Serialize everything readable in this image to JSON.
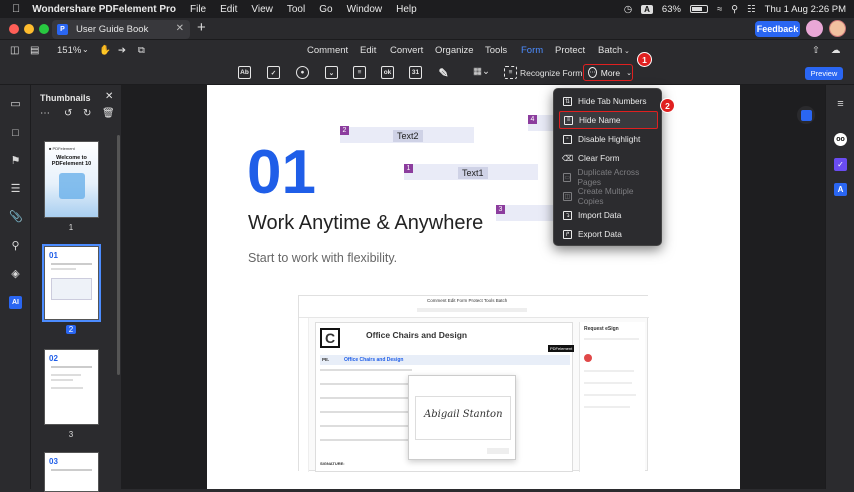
{
  "menubar": {
    "app_name": "Wondershare PDFelement Pro",
    "items": [
      "File",
      "Edit",
      "View",
      "Tool",
      "Go",
      "Window",
      "Help"
    ],
    "input_badge": "A",
    "battery": "63%",
    "datetime": "Thu 1 Aug  2:26 PM"
  },
  "tabbar": {
    "doc_title": "User Guide Book",
    "feedback_label": "Feedback"
  },
  "toolbar": {
    "zoom": "151%",
    "tabs": [
      "Comment",
      "Edit",
      "Convert",
      "Organize",
      "Tools",
      "Form",
      "Protect",
      "Batch"
    ],
    "active_tab": "Form",
    "recognize_form": "Recognize Form",
    "more_label": "More",
    "preview_label": "Preview"
  },
  "thumbnails": {
    "title": "Thumbnails",
    "pages": [
      "1",
      "2",
      "3"
    ],
    "selected": "2",
    "p1_title": "Welcome to PDFelement 10",
    "p2_num": "01",
    "p3_num": "02",
    "p4_num": "03"
  },
  "page": {
    "big_number": "01",
    "heading": "Work Anytime & Anywhere",
    "subheading": "Start to work with flexibility.",
    "fields": [
      {
        "num": "2",
        "label": "Text2"
      },
      {
        "num": "1",
        "label": "Text1"
      },
      {
        "num": "4",
        "label": ""
      },
      {
        "num": "3",
        "label": ""
      }
    ]
  },
  "mini_screenshot": {
    "tabs": "Comment   Edit   Form   Protect   Tools   Batch",
    "doc_title": "Office Chairs and Design",
    "row_header": "Office Chairs and Design",
    "side_title": "Request eSign",
    "signature": "Abigail Stanton",
    "signature_label": "SIGNATURE:"
  },
  "more_menu": {
    "items": [
      {
        "label": "Hide Tab Numbers",
        "icon": "tab-numbers-icon",
        "enabled": true
      },
      {
        "label": "Hide Name",
        "icon": "name-icon",
        "enabled": true
      },
      {
        "label": "Disable Highlight",
        "icon": "highlight-icon",
        "enabled": true
      },
      {
        "label": "Clear Form",
        "icon": "eraser-icon",
        "enabled": true
      },
      {
        "label": "Duplicate Across Pages",
        "icon": "duplicate-icon",
        "enabled": false
      },
      {
        "label": "Create Multiple Copies",
        "icon": "copies-icon",
        "enabled": false
      },
      {
        "label": "Import Data",
        "icon": "import-icon",
        "enabled": true
      },
      {
        "label": "Export Data",
        "icon": "export-icon",
        "enabled": true
      }
    ],
    "highlighted": "Hide Name"
  },
  "callouts": [
    "1",
    "2"
  ],
  "colors": {
    "accent": "#2a66f2",
    "callout": "#e02020",
    "page_number": "#1f5ee8",
    "field_marker": "#8c3d9e"
  }
}
